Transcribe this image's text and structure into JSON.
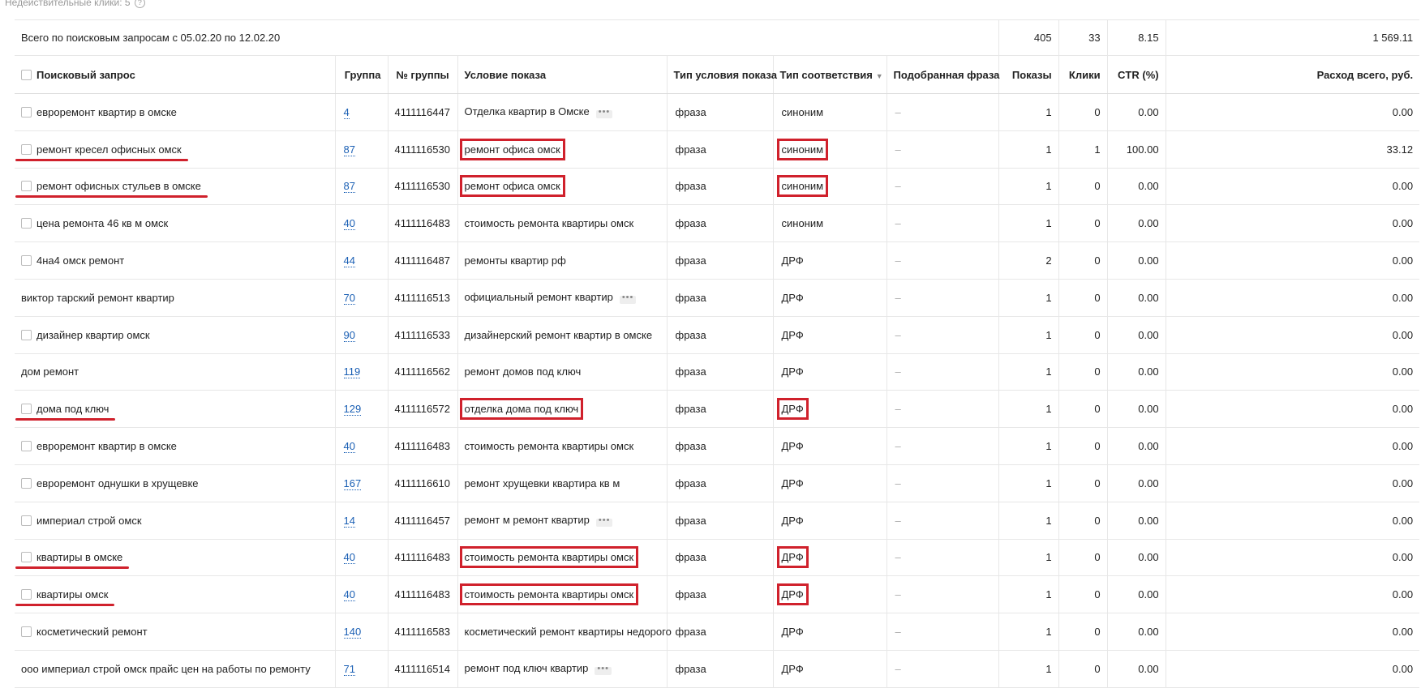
{
  "top_note": {
    "label": "Недействительные клики:",
    "value": "5",
    "help_icon": "question-circle-icon"
  },
  "total": {
    "label": "Всего по поисковым запросам с 05.02.20 по 12.02.20",
    "shows": "405",
    "clicks": "33",
    "ctr": "8.15",
    "cost": "1 569.11"
  },
  "columns": {
    "query": "Поисковый запрос",
    "group": "Группа",
    "group_no": "№ группы",
    "condition": "Условие показа",
    "condition_type": "Тип условия показа",
    "match_type": "Тип соответствия",
    "matched_phrase": "Подобранная фраза",
    "shows": "Показы",
    "clicks": "Клики",
    "ctr": "CTR (%)",
    "cost": "Расход всего, руб."
  },
  "rows": [
    {
      "query": "евроремонт квартир в омске",
      "group": "4",
      "group_no": "4111116447",
      "condition": "Отделка квартир в Омске",
      "condition_type": "фраза",
      "match_type": "синоним",
      "matched": "–",
      "shows": "1",
      "clicks": "0",
      "ctr": "0.00",
      "cost": "0.00"
    },
    {
      "query": "ремонт кресел офисных омск",
      "group": "87",
      "group_no": "4111116530",
      "condition": "ремонт офиса омск",
      "condition_type": "фраза",
      "match_type": "синоним",
      "matched": "–",
      "shows": "1",
      "clicks": "1",
      "ctr": "100.00",
      "cost": "33.12"
    },
    {
      "query": "ремонт офисных стульев в омске",
      "group": "87",
      "group_no": "4111116530",
      "condition": "ремонт офиса омск",
      "condition_type": "фраза",
      "match_type": "синоним",
      "matched": "–",
      "shows": "1",
      "clicks": "0",
      "ctr": "0.00",
      "cost": "0.00"
    },
    {
      "query": "цена ремонта 46 кв м омск",
      "group": "40",
      "group_no": "4111116483",
      "condition": "стоимость ремонта квартиры омск",
      "condition_type": "фраза",
      "match_type": "синоним",
      "matched": "–",
      "shows": "1",
      "clicks": "0",
      "ctr": "0.00",
      "cost": "0.00"
    },
    {
      "query": "4на4 омск ремонт",
      "group": "44",
      "group_no": "4111116487",
      "condition": "ремонты квартир рф",
      "condition_type": "фраза",
      "match_type": "ДРФ",
      "matched": "–",
      "shows": "2",
      "clicks": "0",
      "ctr": "0.00",
      "cost": "0.00"
    },
    {
      "query": "виктор тарский ремонт квартир",
      "group": "70",
      "group_no": "4111116513",
      "condition": "официальный ремонт квартир",
      "condition_type": "фраза",
      "match_type": "ДРФ",
      "matched": "–",
      "shows": "1",
      "clicks": "0",
      "ctr": "0.00",
      "cost": "0.00"
    },
    {
      "query": "дизайнер квартир омск",
      "group": "90",
      "group_no": "4111116533",
      "condition": "дизайнерский ремонт квартир в омске",
      "condition_type": "фраза",
      "match_type": "ДРФ",
      "matched": "–",
      "shows": "1",
      "clicks": "0",
      "ctr": "0.00",
      "cost": "0.00"
    },
    {
      "query": "дом ремонт",
      "group": "119",
      "group_no": "4111116562",
      "condition": "ремонт домов под ключ",
      "condition_type": "фраза",
      "match_type": "ДРФ",
      "matched": "–",
      "shows": "1",
      "clicks": "0",
      "ctr": "0.00",
      "cost": "0.00"
    },
    {
      "query": "дома под ключ",
      "group": "129",
      "group_no": "4111116572",
      "condition": "отделка дома под ключ",
      "condition_type": "фраза",
      "match_type": "ДРФ",
      "matched": "–",
      "shows": "1",
      "clicks": "0",
      "ctr": "0.00",
      "cost": "0.00"
    },
    {
      "query": "евроремонт квартир в омске",
      "group": "40",
      "group_no": "4111116483",
      "condition": "стоимость ремонта квартиры омск",
      "condition_type": "фраза",
      "match_type": "ДРФ",
      "matched": "–",
      "shows": "1",
      "clicks": "0",
      "ctr": "0.00",
      "cost": "0.00"
    },
    {
      "query": "евроремонт однушки в хрущевке",
      "group": "167",
      "group_no": "4111116610",
      "condition": "ремонт хрущевки квартира кв м",
      "condition_type": "фраза",
      "match_type": "ДРФ",
      "matched": "–",
      "shows": "1",
      "clicks": "0",
      "ctr": "0.00",
      "cost": "0.00"
    },
    {
      "query": "империал строй омск",
      "group": "14",
      "group_no": "4111116457",
      "condition": "ремонт м ремонт квартир",
      "condition_type": "фраза",
      "match_type": "ДРФ",
      "matched": "–",
      "shows": "1",
      "clicks": "0",
      "ctr": "0.00",
      "cost": "0.00"
    },
    {
      "query": "квартиры в омске",
      "group": "40",
      "group_no": "4111116483",
      "condition": "стоимость ремонта квартиры омск",
      "condition_type": "фраза",
      "match_type": "ДРФ",
      "matched": "–",
      "shows": "1",
      "clicks": "0",
      "ctr": "0.00",
      "cost": "0.00"
    },
    {
      "query": "квартиры омск",
      "group": "40",
      "group_no": "4111116483",
      "condition": "стоимость ремонта квартиры омск",
      "condition_type": "фраза",
      "match_type": "ДРФ",
      "matched": "–",
      "shows": "1",
      "clicks": "0",
      "ctr": "0.00",
      "cost": "0.00"
    },
    {
      "query": "косметический ремонт",
      "group": "140",
      "group_no": "4111116583",
      "condition": "косметический ремонт квартиры недорого",
      "condition_type": "фраза",
      "match_type": "ДРФ",
      "matched": "–",
      "shows": "1",
      "clicks": "0",
      "ctr": "0.00",
      "cost": "0.00"
    },
    {
      "query": "ооо империал строй омск прайс цен на работы по ремонту",
      "group": "71",
      "group_no": "4111116514",
      "condition": "ремонт под ключ квартир",
      "condition_type": "фраза",
      "match_type": "ДРФ",
      "matched": "–",
      "shows": "1",
      "clicks": "0",
      "ctr": "0.00",
      "cost": "0.00"
    }
  ],
  "row_flags": {
    "checkbox": [
      true,
      true,
      true,
      true,
      true,
      false,
      true,
      false,
      true,
      true,
      true,
      true,
      true,
      true,
      true,
      false
    ],
    "condition_dots": [
      true,
      false,
      false,
      false,
      false,
      true,
      false,
      false,
      false,
      false,
      false,
      true,
      false,
      false,
      false,
      true
    ],
    "highlighted": [
      false,
      true,
      true,
      false,
      false,
      false,
      false,
      false,
      true,
      false,
      false,
      false,
      true,
      true,
      false,
      false
    ]
  },
  "accent_color": "#d0212c",
  "link_color": "#1a5fb4"
}
